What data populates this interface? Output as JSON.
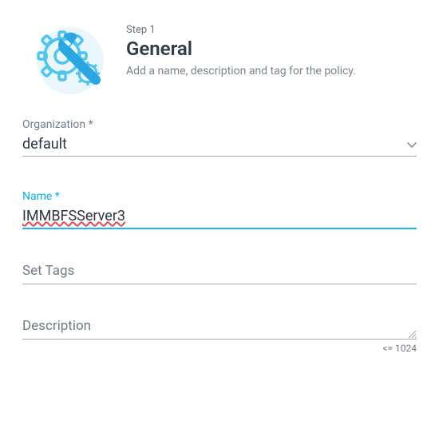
{
  "header": {
    "step": "Step 1",
    "title": "General",
    "subtitle": "Add a name, description and tag for the policy.",
    "icon_name": "gears-wrench-icon"
  },
  "form": {
    "organization": {
      "label": "Organization *",
      "value": "default"
    },
    "name": {
      "label": "Name *",
      "value": "IMMBFSServer3"
    },
    "tags": {
      "label": "Set Tags",
      "value": ""
    },
    "description": {
      "label": "Description",
      "value": "",
      "hint": "<= 1024"
    }
  }
}
